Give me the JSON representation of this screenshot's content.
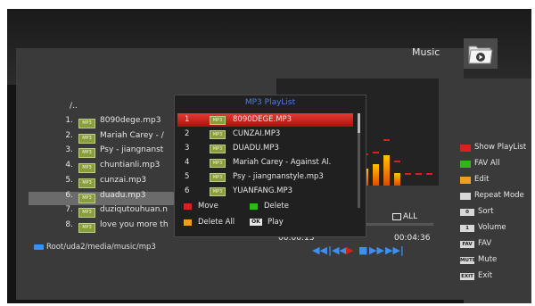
{
  "header": {
    "title": "Music",
    "icon": "music-folder-icon"
  },
  "list": {
    "parent": "/..",
    "items": [
      {
        "num": "1.",
        "badge": "MP3",
        "name": "8090dege.mp3"
      },
      {
        "num": "2.",
        "badge": "MP3",
        "name": "Mariah Carey - /"
      },
      {
        "num": "3.",
        "badge": "MP3",
        "name": "Psy - jiangnanst"
      },
      {
        "num": "4.",
        "badge": "MP3",
        "name": "chuntianli.mp3"
      },
      {
        "num": "5.",
        "badge": "MP3",
        "name": "cunzai.mp3"
      },
      {
        "num": "6.",
        "badge": "MP3",
        "name": "duadu.mp3"
      },
      {
        "num": "7.",
        "badge": "MP3",
        "name": "duziqutouhuan.n"
      },
      {
        "num": "8.",
        "badge": "MP3",
        "name": "love you more th"
      }
    ],
    "selected_index": 5
  },
  "path": "Root/uda2/media/music/mp3",
  "playlist": {
    "title": "MP3 PlayList",
    "items": [
      {
        "num": "1",
        "badge": "MP3",
        "name": "8090DEGE.MP3"
      },
      {
        "num": "2",
        "badge": "MP3",
        "name": "CUNZAI.MP3"
      },
      {
        "num": "3",
        "badge": "MP3",
        "name": "DUADU.MP3"
      },
      {
        "num": "4",
        "badge": "MP3",
        "name": "Mariah Carey - Against Al."
      },
      {
        "num": "5",
        "badge": "MP3",
        "name": "Psy - jiangnanstyle.mp3"
      },
      {
        "num": "6",
        "badge": "MP3",
        "name": "YUANFANG.MP3"
      }
    ],
    "highlighted_index": 0,
    "keys": {
      "move": "Move",
      "delete": "Delete",
      "delete_all": "Delete All",
      "play": "Play",
      "ok": "OK"
    }
  },
  "player": {
    "repeat_label": "ALL",
    "elapsed": "00:00:13",
    "total": "00:04:36",
    "progress": 0.05,
    "controls": [
      "rewind-icon",
      "prev-icon",
      "play-icon",
      "stop-icon",
      "next-icon",
      "fast-forward-icon"
    ]
  },
  "visualizer": {
    "bars": [
      0.0,
      0.0,
      0.0,
      0.0,
      0.0,
      0.0,
      0.0,
      0.0,
      0.0,
      0.0,
      0.0,
      0.0,
      0.0,
      0.0,
      0.0,
      0.0,
      0.0,
      0.0,
      0.0,
      0.0,
      0.22,
      0.28,
      0.32,
      0.0,
      0.0,
      0.0,
      0.0,
      0.0,
      0.0,
      0.0,
      0.0,
      0.0,
      0.0
    ],
    "peaks": [
      0.0
    ]
  },
  "sidebar": {
    "items": [
      {
        "type": "color",
        "color": "#d8231c",
        "label": "Show PlayList"
      },
      {
        "type": "color",
        "color": "#33b51e",
        "label": "FAV All"
      },
      {
        "type": "color",
        "color": "#e8a21d",
        "label": "Edit"
      },
      {
        "type": "color",
        "color": "#d9d9d9",
        "label": "Repeat Mode"
      },
      {
        "type": "key",
        "key": "0",
        "label": "Sort"
      },
      {
        "type": "key",
        "key": "1",
        "label": "Volume"
      },
      {
        "type": "key",
        "key": "FAV",
        "label": "FAV"
      },
      {
        "type": "key",
        "key": "MUTE",
        "label": "Mute"
      },
      {
        "type": "key",
        "key": "EXIT",
        "label": "Exit"
      }
    ]
  },
  "colors": {
    "accent": "#3d8ff0",
    "highlight": "#d6201a",
    "badge": "#8a9d3c"
  }
}
